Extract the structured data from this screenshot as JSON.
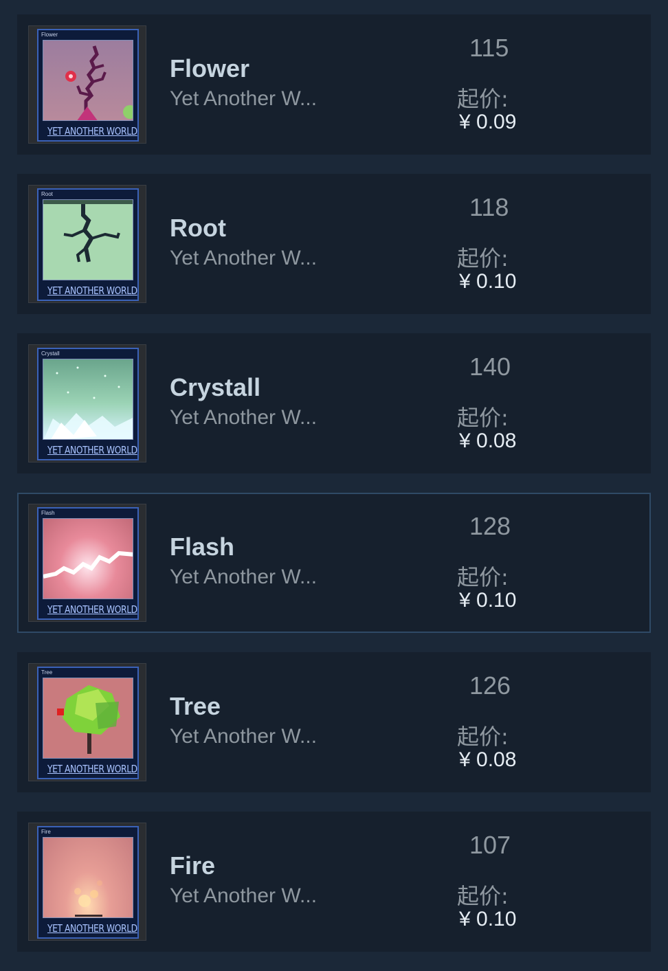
{
  "items": [
    {
      "name": "Flower",
      "game": "Yet Another W...",
      "quantity": "115",
      "start_label": "起价:",
      "price": "¥ 0.09",
      "card_label": "Flower",
      "card_footer": "YET ANOTHER WORLD",
      "selected": false
    },
    {
      "name": "Root",
      "game": "Yet Another W...",
      "quantity": "118",
      "start_label": "起价:",
      "price": "¥ 0.10",
      "card_label": "Root",
      "card_footer": "YET ANOTHER WORLD",
      "selected": false
    },
    {
      "name": "Crystall",
      "game": "Yet Another W...",
      "quantity": "140",
      "start_label": "起价:",
      "price": "¥ 0.08",
      "card_label": "Crystall",
      "card_footer": "YET ANOTHER WORLD",
      "selected": false
    },
    {
      "name": "Flash",
      "game": "Yet Another W...",
      "quantity": "128",
      "start_label": "起价:",
      "price": "¥ 0.10",
      "card_label": "Flash",
      "card_footer": "YET ANOTHER WORLD",
      "selected": true
    },
    {
      "name": "Tree",
      "game": "Yet Another W...",
      "quantity": "126",
      "start_label": "起价:",
      "price": "¥ 0.08",
      "card_label": "Tree",
      "card_footer": "YET ANOTHER WORLD",
      "selected": false
    },
    {
      "name": "Fire",
      "game": "Yet Another W...",
      "quantity": "107",
      "start_label": "起价:",
      "price": "¥ 0.10",
      "card_label": "Fire",
      "card_footer": "YET ANOTHER WORLD",
      "selected": false
    }
  ],
  "colors": {
    "page_bg": "#1b2838",
    "row_bg": "#16202d",
    "selected_border": "#2f4a66",
    "name_text": "#c6d4df",
    "muted_text": "#8f98a0",
    "price_text": "#e6edf3"
  }
}
